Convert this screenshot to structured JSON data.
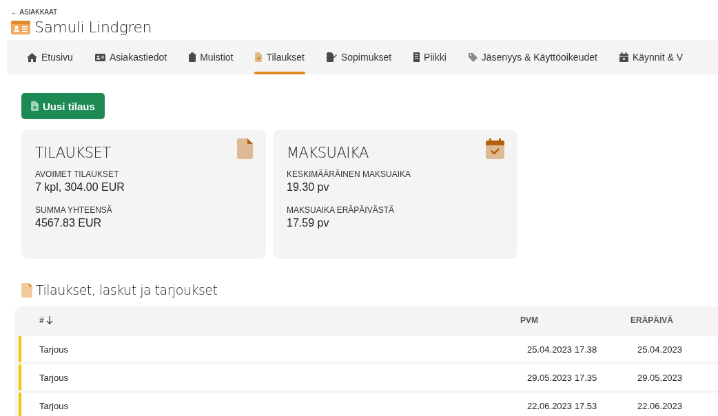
{
  "back_link": {
    "arrow": "←",
    "label": "ASIAKKAAT"
  },
  "title": "Samuli Lindgren",
  "tabs": [
    {
      "label": "Etusivu",
      "selected": false
    },
    {
      "label": "Asiakastiedot",
      "selected": false
    },
    {
      "label": "Muistiot",
      "selected": false
    },
    {
      "label": "Tilaukset",
      "selected": true
    },
    {
      "label": "Sopimukset",
      "selected": false
    },
    {
      "label": "Piikki",
      "selected": false
    },
    {
      "label": "Jäsenyys & Käyttöoikeudet",
      "selected": false
    },
    {
      "label": "Käynnit & V",
      "selected": false
    }
  ],
  "new_order_button": "Uusi tilaus",
  "cards": [
    {
      "title": "TILAUKSET",
      "stats": [
        {
          "label": "AVOIMET TILAUKSET",
          "value": "7 kpl, 304.00 EUR"
        },
        {
          "label": "SUMMA YHTEENSÄ",
          "value": "4567.83 EUR"
        }
      ]
    },
    {
      "title": "MAKSUAIKA",
      "stats": [
        {
          "label": "KESKIMÄÄRÄINEN MAKSUAIKA",
          "value": "19.30 pv"
        },
        {
          "label": "MAKSUAIKA ERÄPÄIVÄSTÄ",
          "value": "17.59 pv"
        }
      ]
    }
  ],
  "section_title": "Tilaukset, laskut ja tarjoukset",
  "table": {
    "columns": [
      "#",
      "PVM",
      "ERÄPÄIVÄ"
    ],
    "rows": [
      {
        "type": "Tarjous",
        "date": "25.04.2023 17.38",
        "due": "25.04.2023",
        "color": "#f5c400"
      },
      {
        "type": "Tarjous",
        "date": "29.05.2023 17.35",
        "due": "29.05.2023",
        "color": "#f5c400"
      },
      {
        "type": "Tarjous",
        "date": "22.06.2023 17.53",
        "due": "22.06.2023",
        "color": "#f5c400"
      }
    ]
  }
}
